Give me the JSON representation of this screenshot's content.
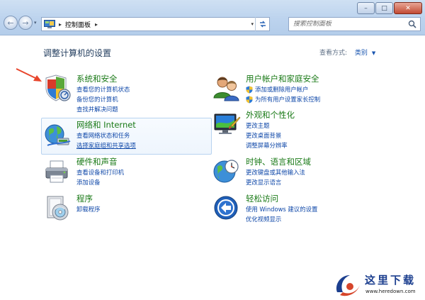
{
  "window": {
    "minimize_label": "–",
    "maximize_label": "□",
    "close_label": "✕"
  },
  "address": {
    "crumb": "控制面板"
  },
  "search": {
    "placeholder": "搜索控制面板"
  },
  "header": {
    "title": "调整计算机的设置",
    "view_by_label": "查看方式:",
    "view_by_value": "类别"
  },
  "categories": {
    "system": {
      "title": "系统和安全",
      "links": [
        "查看您的计算机状态",
        "备份您的计算机",
        "查找并解决问题"
      ]
    },
    "network": {
      "title": "网络和 Internet",
      "links": [
        "查看网络状态和任务",
        "选择家庭组和共享选项"
      ]
    },
    "hardware": {
      "title": "硬件和声音",
      "links": [
        "查看设备和打印机",
        "添加设备"
      ]
    },
    "programs": {
      "title": "程序",
      "links": [
        "卸载程序"
      ]
    },
    "users": {
      "title": "用户帐户和家庭安全",
      "links": [
        "添加或删除用户帐户",
        "为所有用户设置家长控制"
      ]
    },
    "appearance": {
      "title": "外观和个性化",
      "links": [
        "更改主题",
        "更改桌面背景",
        "调整屏幕分辨率"
      ]
    },
    "clock": {
      "title": "时钟、语言和区域",
      "links": [
        "更改键盘或其他输入法",
        "更改显示语言"
      ]
    },
    "ease": {
      "title": "轻松访问",
      "links": [
        "使用 Windows 建议的设置",
        "优化视频显示"
      ]
    }
  },
  "watermark": {
    "title": "这里下载",
    "url": "www.heredown.com"
  },
  "colors": {
    "heading_green": "#1a7a17",
    "link_blue": "#0e47a8",
    "frame_blue": "#bcd3ee",
    "arrow_red": "#e8452c"
  }
}
